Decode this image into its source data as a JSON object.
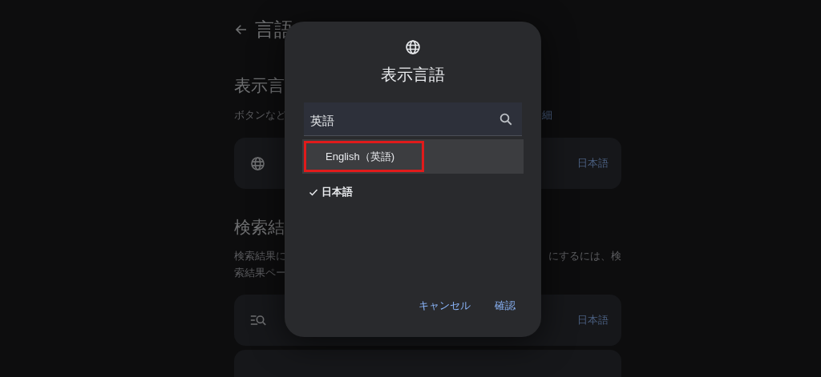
{
  "page": {
    "title": "言語",
    "display_section": {
      "heading": "表示言",
      "description": "ボタンなど",
      "link": "細",
      "row": {
        "value": "日本語"
      }
    },
    "search_section": {
      "heading": "検索結",
      "description_lines": [
        {
          "left": "検索結果に",
          "right": "にするには、検"
        },
        {
          "left": "索結果ペー"
        }
      ],
      "row": {
        "value": "日本語"
      }
    }
  },
  "dialog": {
    "title": "表示言語",
    "search": {
      "value": "英語"
    },
    "suggestions": [
      {
        "label": "English（英語)",
        "highlighted": true,
        "annotated": true
      }
    ],
    "languages": [
      {
        "label": "日本語",
        "checked": true
      }
    ],
    "buttons": [
      {
        "label": "キャンセル"
      },
      {
        "label": "確認"
      }
    ]
  }
}
